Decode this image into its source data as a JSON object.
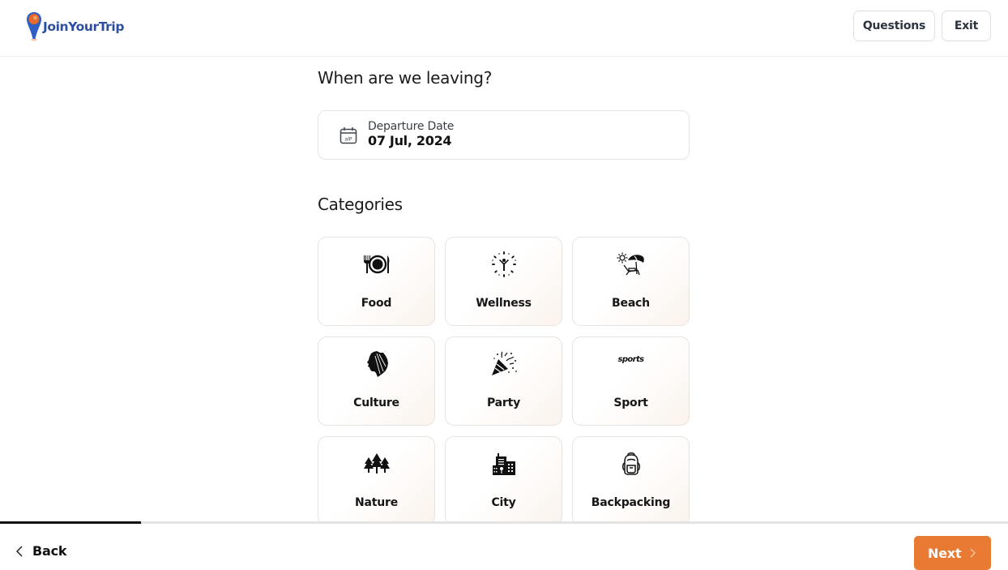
{
  "header": {
    "brand": "JoinYourTrip",
    "buttons": {
      "questions": "Questions",
      "exit": "Exit"
    }
  },
  "departure": {
    "title": "When are we leaving?",
    "field_label": "Departure Date",
    "field_value": "07 Jul, 2024",
    "icon": "calendar-icon"
  },
  "categories": {
    "title": "Categories",
    "items": [
      {
        "label": "Food",
        "icon": "food-plate-icon"
      },
      {
        "label": "Wellness",
        "icon": "wellness-icon"
      },
      {
        "label": "Beach",
        "icon": "beach-umbrella-icon"
      },
      {
        "label": "Culture",
        "icon": "culture-headdress-icon"
      },
      {
        "label": "Party",
        "icon": "party-popper-icon"
      },
      {
        "label": "Sport",
        "icon": "sports-icon",
        "icon_text": "sports"
      },
      {
        "label": "Nature",
        "icon": "trees-icon"
      },
      {
        "label": "City",
        "icon": "city-buildings-icon"
      },
      {
        "label": "Backpacking",
        "icon": "backpack-icon"
      }
    ]
  },
  "progress": {
    "percent": 14
  },
  "footer": {
    "back": "Back",
    "next": "Next"
  },
  "colors": {
    "accent": "#e87a33",
    "brand": "#2d4fa2",
    "progress": "#111111"
  }
}
